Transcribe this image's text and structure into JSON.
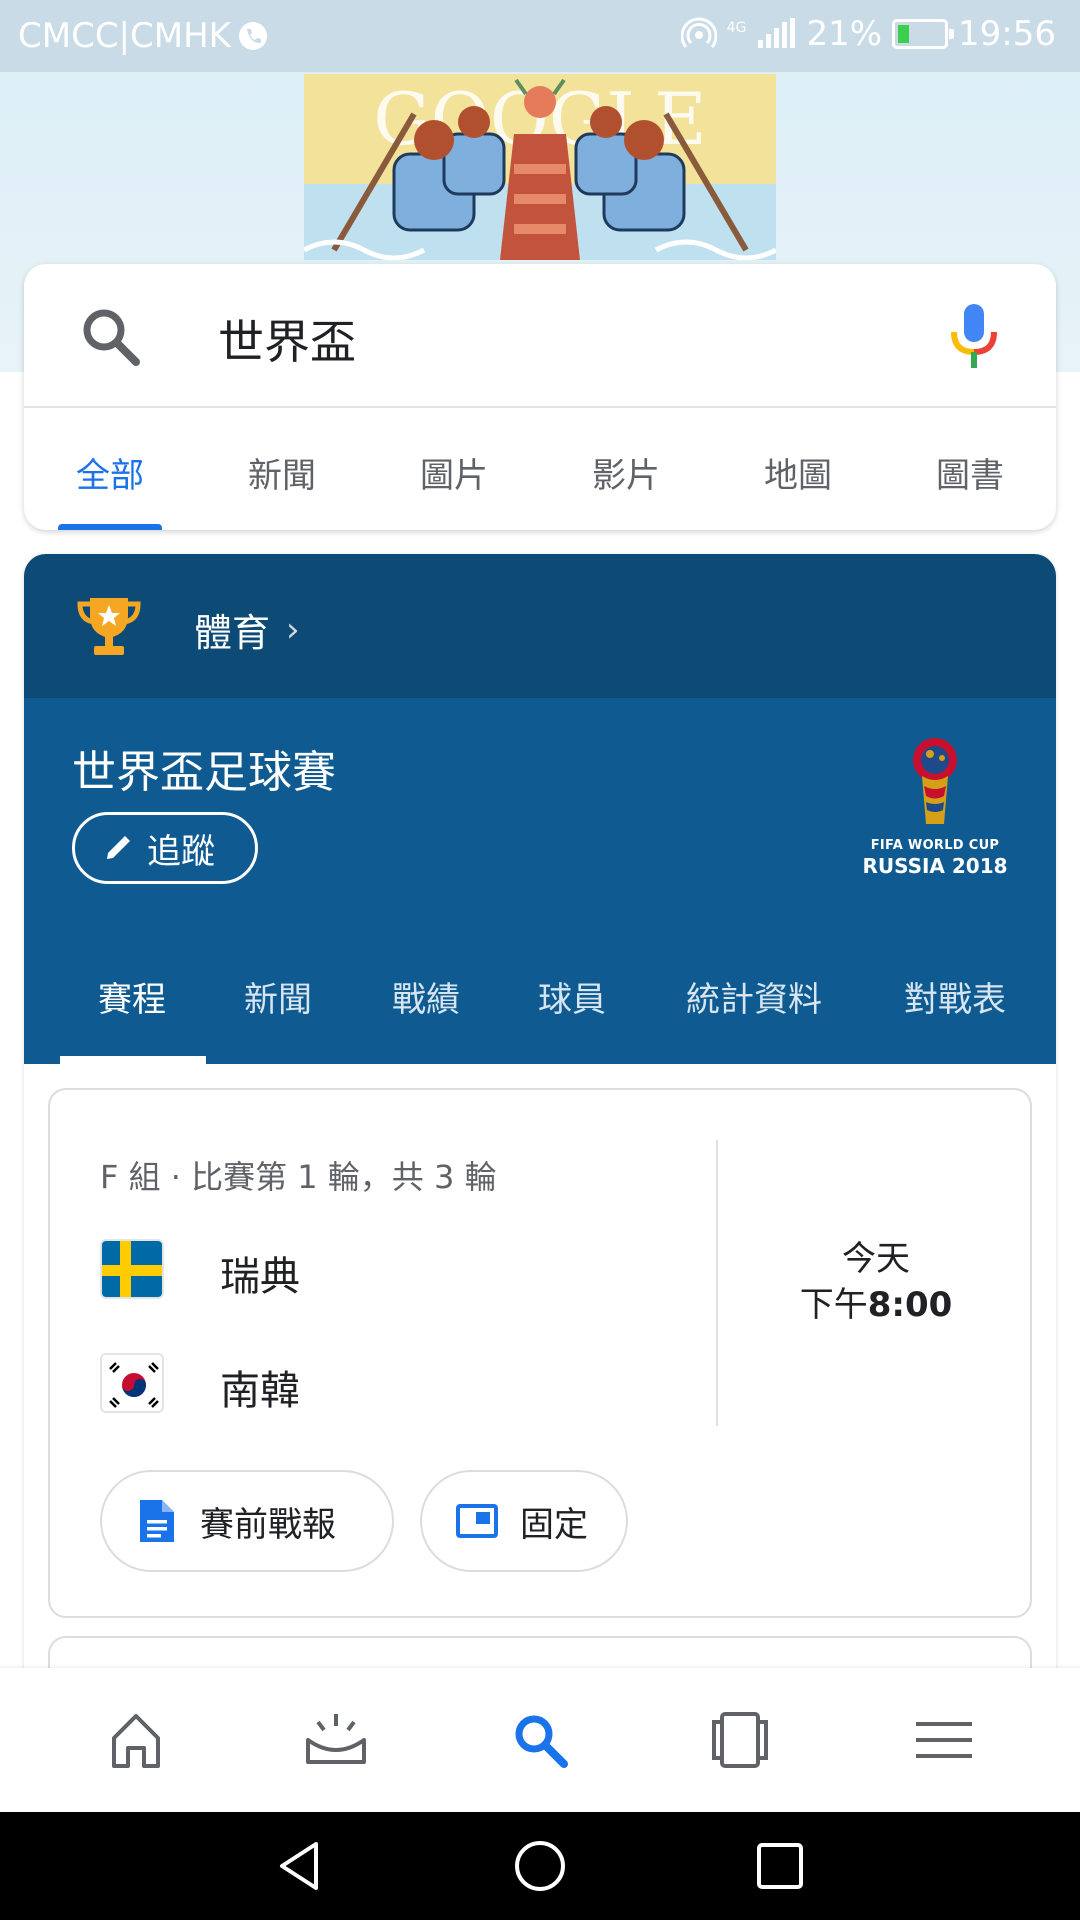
{
  "status_bar": {
    "carrier": "CMCC|CMHK",
    "network": "4G",
    "battery": "21%",
    "battery_level": 0.21,
    "time": "19:56"
  },
  "doodle": {
    "text": "GOOGLE"
  },
  "search": {
    "query": "世界盃",
    "tabs": [
      "全部",
      "新聞",
      "圖片",
      "影片",
      "地圖",
      "圖書"
    ],
    "active_tab": "全部"
  },
  "sports": {
    "category": "體育",
    "title": "世界盃足球賽",
    "follow_label": "追蹤",
    "logo_line1": "FIFA WORLD CUP",
    "logo_line2": "RUSSIA 2018",
    "tabs": [
      "賽程",
      "新聞",
      "戰績",
      "球員",
      "統計資料",
      "對戰表"
    ],
    "active_tab": "賽程"
  },
  "match": {
    "group": "F 組 · 比賽第 1 輪，共 3 輪",
    "team1": "瑞典",
    "team2": "南韓",
    "day": "今天",
    "time_prefix": "下午",
    "time": "8:00",
    "preview_label": "賽前戰報",
    "pin_label": "固定"
  },
  "colors": {
    "accent": "#1a73e8",
    "header_dark": "#0d4a75",
    "header": "#0f5a90",
    "trophy": "#f5a623"
  },
  "bottom_nav": [
    "home-icon",
    "updates-icon",
    "search-icon",
    "tabs-icon",
    "menu-icon"
  ],
  "active_bottom_nav": "search-icon"
}
